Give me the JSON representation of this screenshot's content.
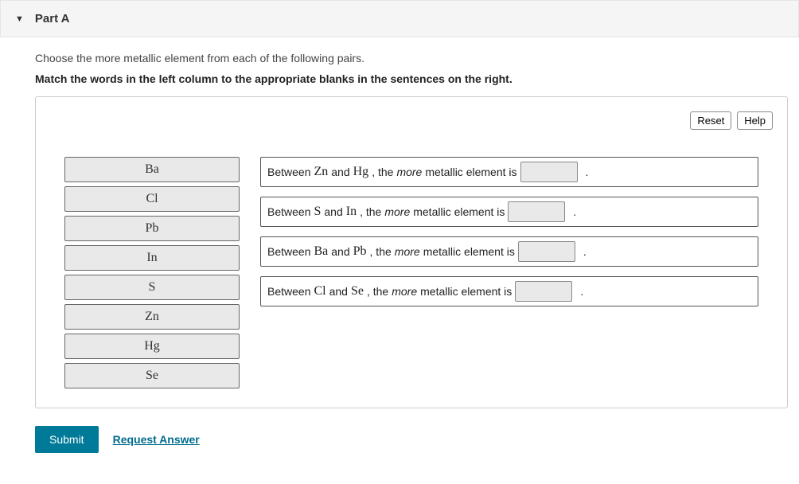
{
  "header": {
    "title": "Part A"
  },
  "prompt": "Choose the more metallic element from each of the following pairs.",
  "instruction": "Match the words in the left column to the appropriate blanks in the sentences on the right.",
  "buttons": {
    "reset": "Reset",
    "help": "Help",
    "submit": "Submit",
    "request": "Request Answer"
  },
  "word_bank": [
    "Ba",
    "Cl",
    "Pb",
    "In",
    "S",
    "Zn",
    "Hg",
    "Se"
  ],
  "sentences": [
    {
      "pre": "Between ",
      "el1": "Zn",
      "mid1": " and ",
      "el2": "Hg",
      "mid2": ", the ",
      "more": "more",
      "post": " metallic element is "
    },
    {
      "pre": "Between ",
      "el1": "S",
      "mid1": " and ",
      "el2": "In",
      "mid2": ", the ",
      "more": "more",
      "post": " metallic element is "
    },
    {
      "pre": "Between ",
      "el1": "Ba",
      "mid1": " and ",
      "el2": "Pb",
      "mid2": ", the ",
      "more": "more",
      "post": " metallic element is "
    },
    {
      "pre": "Between ",
      "el1": "Cl",
      "mid1": " and ",
      "el2": "Se",
      "mid2": ", the ",
      "more": "more",
      "post": " metallic element is "
    }
  ]
}
